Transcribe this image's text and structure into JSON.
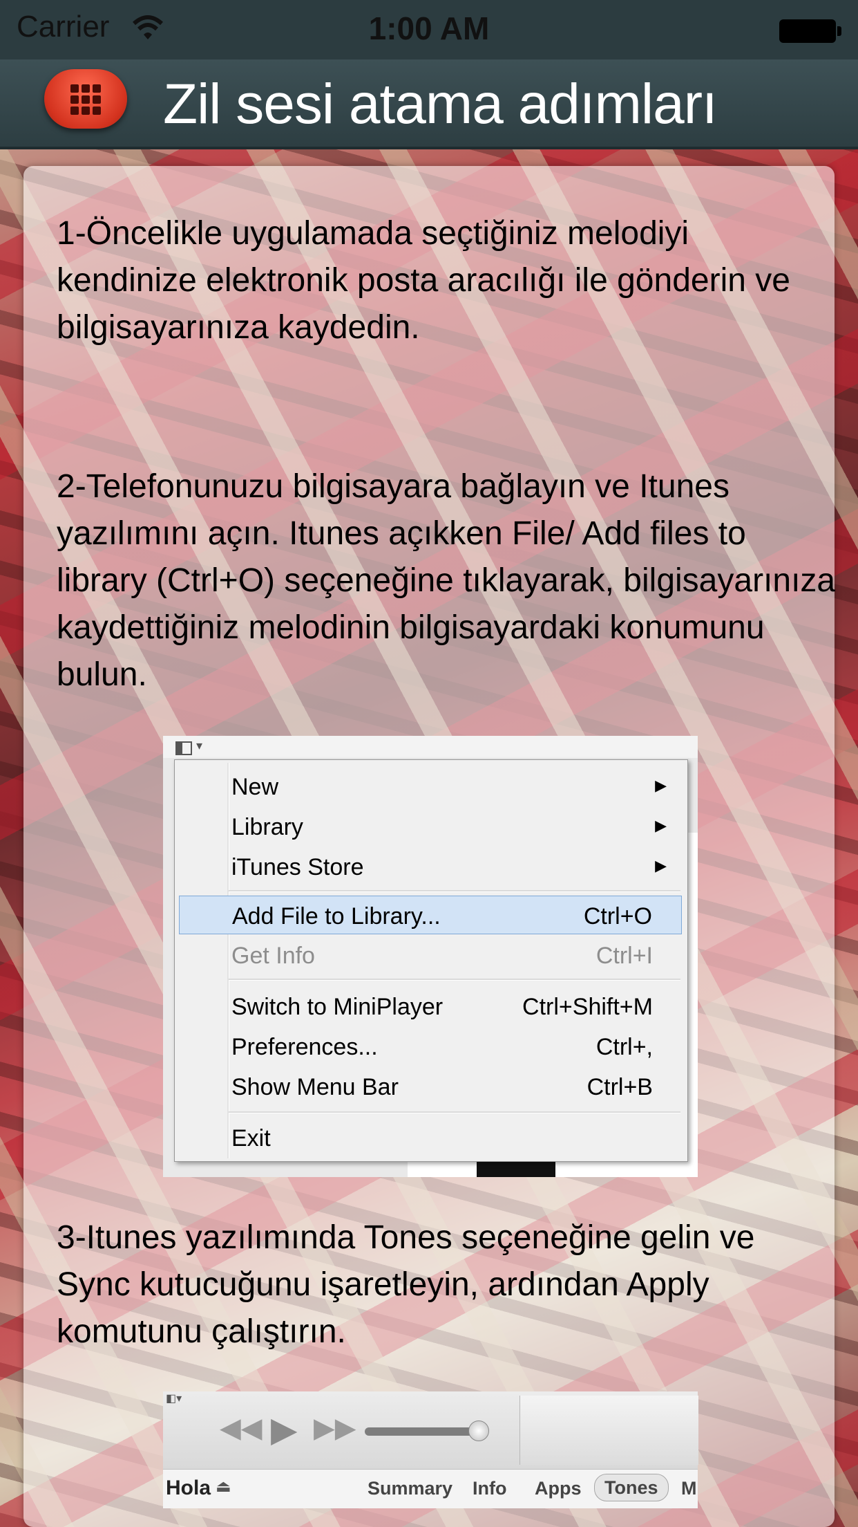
{
  "status_bar": {
    "carrier": "Carrier",
    "time": "1:00 AM"
  },
  "nav": {
    "title": "Zil sesi atama adımları"
  },
  "steps": [
    "1-Öncelikle uygulamada seçtiğiniz melodiyi kendinize elektronik posta aracılığı ile gönderin ve bilgisayarınıza kaydedin.",
    "2-Telefonunuzu bilgisayara bağlayın ve Itunes yazılımını açın. Itunes açıkken File/ Add files to library (Ctrl+O) seçeneğine tıklayarak, bilgisayarınıza kaydettiğiniz melodinin bilgisayardaki konumunu bulun.",
    "3-Itunes yazılımında Tones seçeneğine gelin ve Sync kutucuğunu işaretleyin, ardından Apply komutunu çalıştırın."
  ],
  "menu_screenshot": {
    "items": [
      {
        "label": "New",
        "shortcut": "",
        "submenu": true
      },
      {
        "label": "Library",
        "shortcut": "",
        "submenu": true
      },
      {
        "label": "iTunes Store",
        "shortcut": "",
        "submenu": true
      },
      {
        "label": "Add File to Library...",
        "shortcut": "Ctrl+O",
        "highlighted": true
      },
      {
        "label": "Get Info",
        "shortcut": "Ctrl+I",
        "disabled": true
      },
      {
        "label": "Switch to MiniPlayer",
        "shortcut": "Ctrl+Shift+M"
      },
      {
        "label": "Preferences...",
        "shortcut": "Ctrl+,"
      },
      {
        "label": "Show Menu Bar",
        "shortcut": "Ctrl+B"
      },
      {
        "label": "Exit",
        "shortcut": ""
      }
    ]
  },
  "itunes_screenshot": {
    "device_name": "Hola",
    "tabs": [
      "Summary",
      "Info",
      "Apps",
      "Tones",
      "M"
    ],
    "selected_tab": "Tones"
  },
  "icons": {
    "menu_button": "grid-icon",
    "status": [
      "wifi-icon",
      "battery-icon"
    ]
  },
  "colors": {
    "nav_bar": "#2d3e42",
    "menu_button": "#e0402a",
    "title": "#ffffff"
  }
}
